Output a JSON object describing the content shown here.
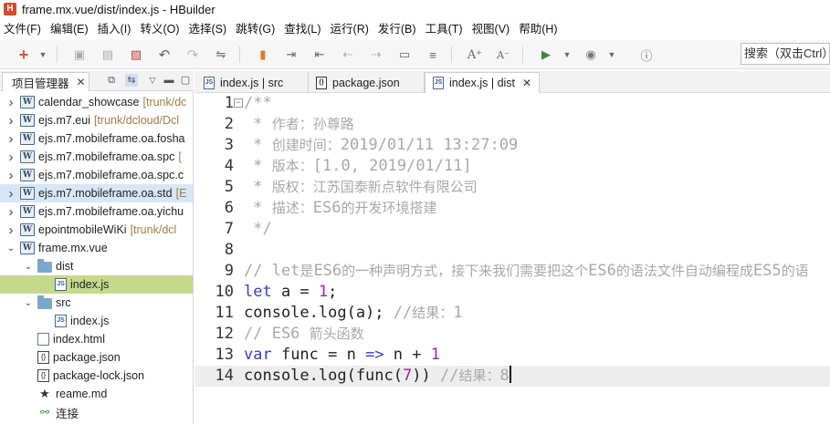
{
  "window": {
    "logo_letter": "H",
    "title": "frame.mx.vue/dist/index.js  -  HBuilder"
  },
  "menu": [
    "文件(F)",
    "编辑(E)",
    "插入(I)",
    "转义(O)",
    "选择(S)",
    "跳转(G)",
    "查找(L)",
    "运行(R)",
    "发行(B)",
    "工具(T)",
    "视图(V)",
    "帮助(H)"
  ],
  "toolbar": {
    "search_placeholder": "搜索（双击Ctrl）"
  },
  "left_panel": {
    "tab_label": "项目管理器",
    "tree": [
      {
        "label": "calendar_showcase",
        "meta": "[trunk/dc",
        "type": "project",
        "depth": 0,
        "chevron": "right"
      },
      {
        "label": "ejs.m7.eui",
        "meta": "[trunk/dcloud/Dcl",
        "type": "project",
        "depth": 0,
        "chevron": "right"
      },
      {
        "label": "ejs.m7.mobileframe.oa.fosha",
        "meta": "",
        "type": "project",
        "depth": 0,
        "chevron": "right"
      },
      {
        "label": "ejs.m7.mobileframe.oa.spc",
        "meta": "[",
        "type": "project",
        "depth": 0,
        "chevron": "right"
      },
      {
        "label": "ejs.m7.mobileframe.oa.spc.c",
        "meta": "",
        "type": "project",
        "depth": 0,
        "chevron": "right"
      },
      {
        "label": "ejs.m7.mobileframe.oa.std",
        "meta": "[E",
        "type": "project",
        "depth": 0,
        "chevron": "right",
        "selected": true
      },
      {
        "label": "ejs.m7.mobileframe.oa.yichu",
        "meta": "",
        "type": "project",
        "depth": 0,
        "chevron": "right"
      },
      {
        "label": "epointmobileWiKi",
        "meta": "[trunk/dcl",
        "type": "project",
        "depth": 0,
        "chevron": "right"
      },
      {
        "label": "frame.mx.vue",
        "meta": "",
        "type": "project",
        "depth": 0,
        "chevron": "down"
      },
      {
        "label": "dist",
        "meta": "",
        "type": "folder",
        "depth": 1,
        "chevron": "down"
      },
      {
        "label": "index.js",
        "meta": "",
        "type": "js",
        "depth": 2,
        "chevron": "",
        "current": true
      },
      {
        "label": "src",
        "meta": "",
        "type": "folder",
        "depth": 1,
        "chevron": "down"
      },
      {
        "label": "index.js",
        "meta": "",
        "type": "js",
        "depth": 2,
        "chevron": ""
      },
      {
        "label": "index.html",
        "meta": "",
        "type": "html",
        "depth": 1,
        "chevron": ""
      },
      {
        "label": "package.json",
        "meta": "",
        "type": "json",
        "depth": 1,
        "chevron": ""
      },
      {
        "label": "package-lock.json",
        "meta": "",
        "type": "json",
        "depth": 1,
        "chevron": ""
      },
      {
        "label": "reame.md",
        "meta": "",
        "type": "md",
        "depth": 1,
        "chevron": ""
      },
      {
        "label": "连接",
        "meta": "",
        "type": "link",
        "depth": 1,
        "chevron": ""
      }
    ]
  },
  "editor": {
    "tabs": [
      {
        "label": "index.js | src",
        "icon": "js-file-icon",
        "active": false
      },
      {
        "label": "package.json",
        "icon": "json-file-icon",
        "active": false
      },
      {
        "label": "index.js | dist",
        "icon": "js-file-icon",
        "active": true,
        "closable": true
      }
    ],
    "current_line": 14,
    "lines": [
      {
        "n": "1",
        "fold": "−",
        "tokens": [
          {
            "t": "/**",
            "c": "cm"
          }
        ]
      },
      {
        "n": "2",
        "tokens": [
          {
            "t": " * ",
            "c": "cm"
          },
          {
            "t": "作者：孙尊路",
            "c": "cm-cjk"
          }
        ]
      },
      {
        "n": "3",
        "tokens": [
          {
            "t": " * ",
            "c": "cm"
          },
          {
            "t": "创建时间：",
            "c": "cm-cjk"
          },
          {
            "t": "2019/01/11 13:27:09",
            "c": "cm"
          }
        ]
      },
      {
        "n": "4",
        "tokens": [
          {
            "t": " * ",
            "c": "cm"
          },
          {
            "t": "版本：",
            "c": "cm-cjk"
          },
          {
            "t": "[1.0, 2019/01/11]",
            "c": "cm"
          }
        ]
      },
      {
        "n": "5",
        "tokens": [
          {
            "t": " * ",
            "c": "cm"
          },
          {
            "t": "版权：江苏国泰新点软件有限公司",
            "c": "cm-cjk"
          }
        ]
      },
      {
        "n": "6",
        "tokens": [
          {
            "t": " * ",
            "c": "cm"
          },
          {
            "t": "描述：",
            "c": "cm-cjk"
          },
          {
            "t": "ES6",
            "c": "cm"
          },
          {
            "t": "的开发环境搭建",
            "c": "cm-cjk"
          }
        ]
      },
      {
        "n": "7",
        "tokens": [
          {
            "t": " */",
            "c": "cm"
          }
        ]
      },
      {
        "n": "8",
        "tokens": []
      },
      {
        "n": "9",
        "tokens": [
          {
            "t": "// let",
            "c": "cm"
          },
          {
            "t": "是",
            "c": "cm-cjk"
          },
          {
            "t": "ES6",
            "c": "cm"
          },
          {
            "t": "的一种声明方式，接下来我们需要把这个",
            "c": "cm-cjk"
          },
          {
            "t": "ES6",
            "c": "cm"
          },
          {
            "t": "的语法文件自动编程成",
            "c": "cm-cjk"
          },
          {
            "t": "ES5",
            "c": "cm"
          },
          {
            "t": "的语",
            "c": "cm-cjk"
          }
        ]
      },
      {
        "n": "10",
        "tokens": [
          {
            "t": "let",
            "c": "kw"
          },
          {
            "t": " a = ",
            "c": "op"
          },
          {
            "t": "1",
            "c": "num"
          },
          {
            "t": ";",
            "c": "op"
          }
        ]
      },
      {
        "n": "11",
        "tokens": [
          {
            "t": "console.log(a); ",
            "c": "op"
          },
          {
            "t": "//",
            "c": "cm"
          },
          {
            "t": "结果：",
            "c": "cm-cjk"
          },
          {
            "t": "1",
            "c": "cm"
          }
        ]
      },
      {
        "n": "12",
        "tokens": [
          {
            "t": "// ES6 ",
            "c": "cm"
          },
          {
            "t": "箭头函数",
            "c": "cm-cjk"
          }
        ]
      },
      {
        "n": "13",
        "tokens": [
          {
            "t": "var",
            "c": "kw"
          },
          {
            "t": " func = n ",
            "c": "op"
          },
          {
            "t": "=>",
            "c": "kw"
          },
          {
            "t": " n + ",
            "c": "op"
          },
          {
            "t": "1",
            "c": "num"
          }
        ]
      },
      {
        "n": "14",
        "tokens": [
          {
            "t": "console.log(func(",
            "c": "op"
          },
          {
            "t": "7",
            "c": "num"
          },
          {
            "t": ")) ",
            "c": "op"
          },
          {
            "t": "//",
            "c": "cm"
          },
          {
            "t": "结果：",
            "c": "cm-cjk"
          },
          {
            "t": "8",
            "c": "cm"
          }
        ],
        "caret": true
      }
    ]
  },
  "colors": {
    "keyword": "#3a3ad0",
    "number": "#a020a0",
    "comment": "#a8a8a8",
    "current_file_highlight": "#c4d98c",
    "selected_row": "#d7e6f7",
    "app_logo": "#d94b2b"
  }
}
